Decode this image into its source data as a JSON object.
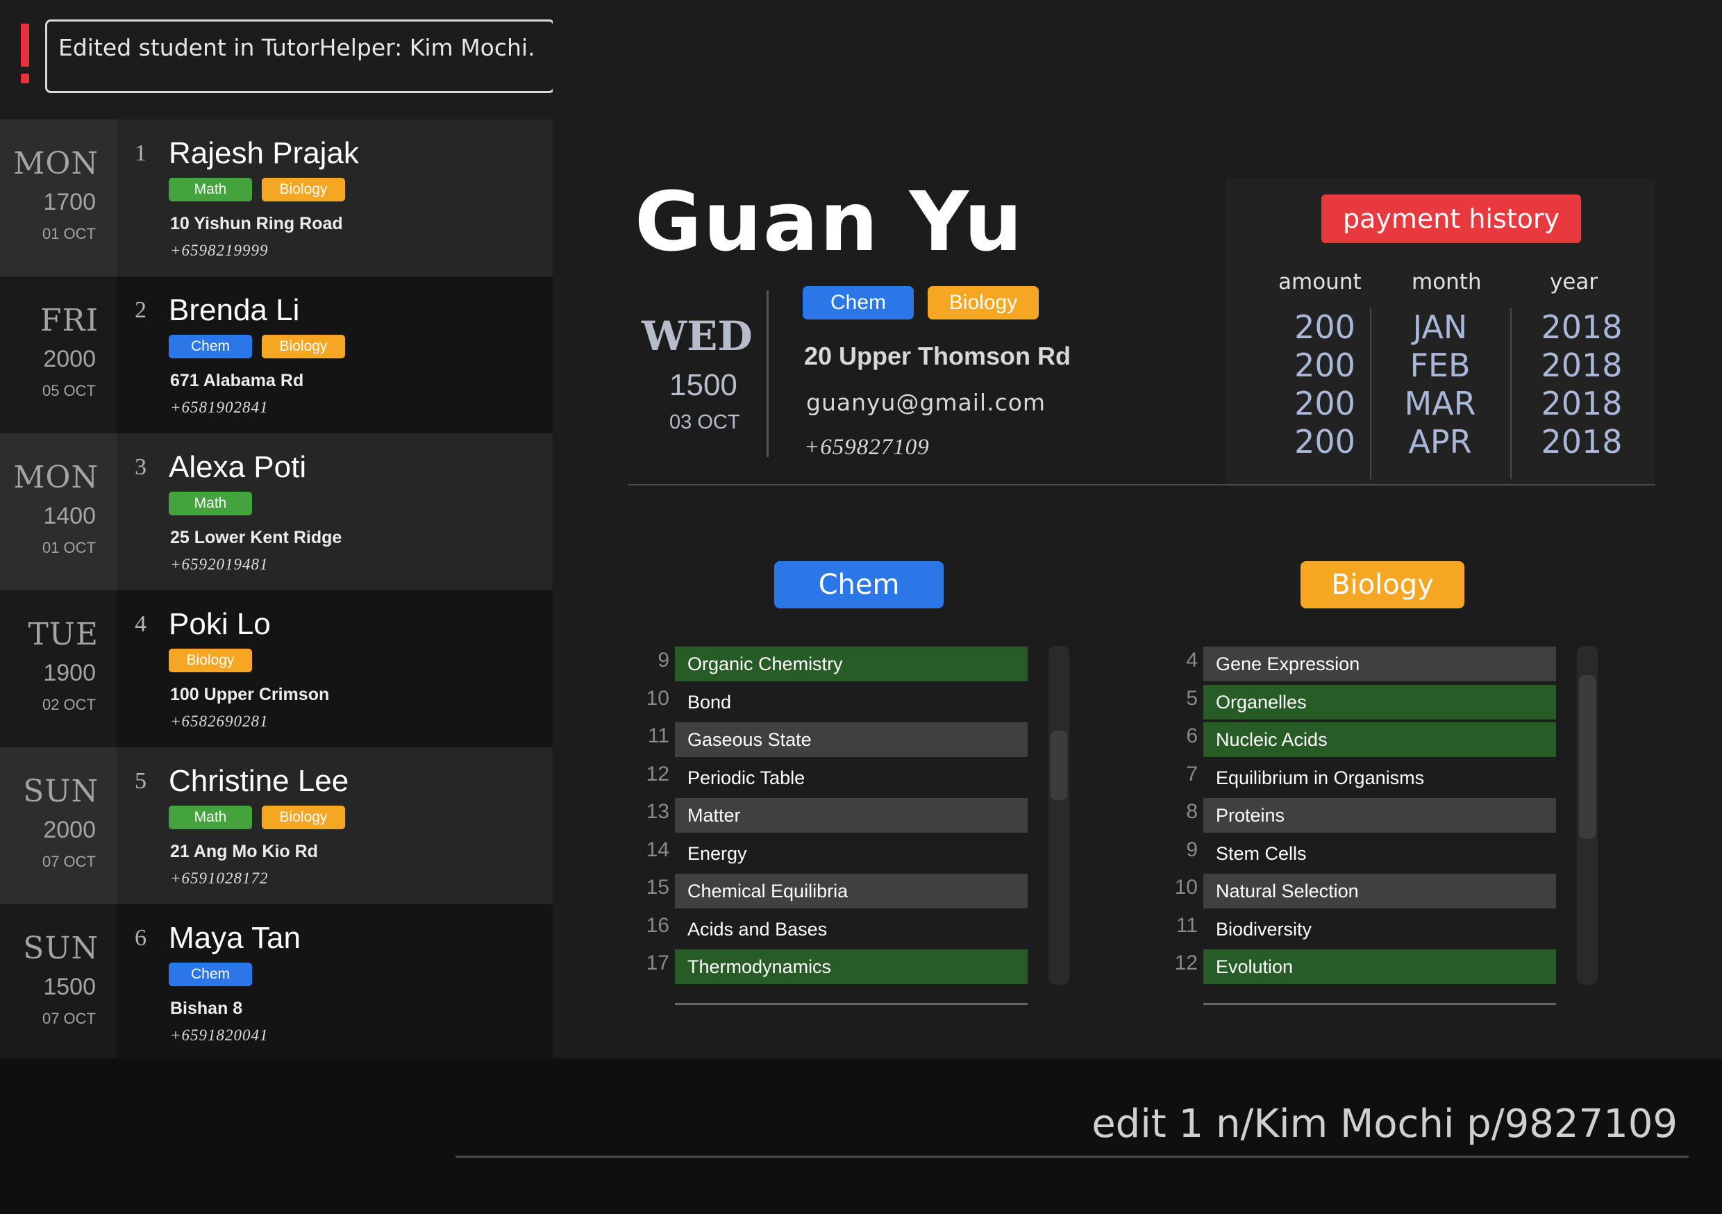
{
  "result": {
    "message": "Edited student in TutorHelper: Kim Mochi."
  },
  "students": [
    {
      "index": "1",
      "day": "MON",
      "time": "1700",
      "date": "01 OCT",
      "name": "Rajesh Prajak",
      "tags": [
        {
          "label": "Math",
          "color": "#44a33c"
        },
        {
          "label": "Biology",
          "color": "#f5a623"
        }
      ],
      "address": "10 Yishun Ring Road",
      "phone": "+6598219999"
    },
    {
      "index": "2",
      "day": "FRI",
      "time": "2000",
      "date": "05 OCT",
      "name": "Brenda Li",
      "tags": [
        {
          "label": "Chem",
          "color": "#2c77e8"
        },
        {
          "label": "Biology",
          "color": "#f5a623"
        }
      ],
      "address": "671 Alabama Rd",
      "phone": "+6581902841"
    },
    {
      "index": "3",
      "day": "MON",
      "time": "1400",
      "date": "01 OCT",
      "name": "Alexa Poti",
      "tags": [
        {
          "label": "Math",
          "color": "#44a33c"
        }
      ],
      "address": "25 Lower Kent Ridge",
      "phone": "+6592019481"
    },
    {
      "index": "4",
      "day": "TUE",
      "time": "1900",
      "date": "02 OCT",
      "name": "Poki Lo",
      "tags": [
        {
          "label": "Biology",
          "color": "#f5a623"
        }
      ],
      "address": "100 Upper Crimson",
      "phone": "+6582690281"
    },
    {
      "index": "5",
      "day": "SUN",
      "time": "2000",
      "date": "07 OCT",
      "name": "Christine Lee",
      "tags": [
        {
          "label": "Math",
          "color": "#44a33c"
        },
        {
          "label": "Biology",
          "color": "#f5a623"
        }
      ],
      "address": "21 Ang Mo Kio Rd",
      "phone": "+6591028172"
    },
    {
      "index": "6",
      "day": "SUN",
      "time": "1500",
      "date": "07 OCT",
      "name": "Maya Tan",
      "tags": [
        {
          "label": "Chem",
          "color": "#2c77e8"
        }
      ],
      "address": "Bishan 8",
      "phone": "+6591820041"
    }
  ],
  "details": {
    "name": "Guan Yu",
    "day": "WED",
    "time": "1500",
    "date": "03 OCT",
    "tags": [
      {
        "label": "Chem",
        "color": "#2c77e8"
      },
      {
        "label": "Biology",
        "color": "#f5a623"
      }
    ],
    "address": "20 Upper Thomson Rd",
    "email": "guanyu@gmail.com",
    "phone": "+659827109"
  },
  "payment": {
    "button_label": "payment history",
    "headers": {
      "amount": "amount",
      "month": "month",
      "year": "year"
    },
    "rows": [
      {
        "amount": "200",
        "month": "JAN",
        "year": "2018"
      },
      {
        "amount": "200",
        "month": "FEB",
        "year": "2018"
      },
      {
        "amount": "200",
        "month": "MAR",
        "year": "2018"
      },
      {
        "amount": "200",
        "month": "APR",
        "year": "2018"
      }
    ]
  },
  "subjects": [
    {
      "label": "Chem",
      "color": "#2c77e8",
      "topics": [
        {
          "num": "9",
          "name": "Organic Chemistry",
          "state": "done"
        },
        {
          "num": "10",
          "name": "Bond",
          "state": "plain"
        },
        {
          "num": "11",
          "name": "Gaseous State",
          "state": "gray"
        },
        {
          "num": "12",
          "name": "Periodic Table",
          "state": "plain"
        },
        {
          "num": "13",
          "name": "Matter",
          "state": "gray"
        },
        {
          "num": "14",
          "name": "Energy",
          "state": "plain"
        },
        {
          "num": "15",
          "name": "Chemical Equilibria",
          "state": "gray"
        },
        {
          "num": "16",
          "name": "Acids and Bases",
          "state": "plain"
        },
        {
          "num": "17",
          "name": "Thermodynamics",
          "state": "done"
        }
      ]
    },
    {
      "label": "Biology",
      "color": "#f5a623",
      "topics": [
        {
          "num": "4",
          "name": "Gene Expression",
          "state": "gray"
        },
        {
          "num": "5",
          "name": "Organelles",
          "state": "done"
        },
        {
          "num": "6",
          "name": "Nucleic Acids",
          "state": "done"
        },
        {
          "num": "7",
          "name": "Equilibrium in Organisms",
          "state": "plain"
        },
        {
          "num": "8",
          "name": "Proteins",
          "state": "gray"
        },
        {
          "num": "9",
          "name": "Stem Cells",
          "state": "plain"
        },
        {
          "num": "10",
          "name": "Natural Selection",
          "state": "gray"
        },
        {
          "num": "11",
          "name": "Biodiversity",
          "state": "plain"
        },
        {
          "num": "12",
          "name": "Evolution",
          "state": "done"
        }
      ]
    }
  ],
  "command": {
    "value": "edit 1 n/Kim Mochi p/9827109"
  },
  "icons": {
    "result_status": "exclamation-icon"
  },
  "colors": {
    "alert": "#e83a3e",
    "completed": "#275c27",
    "math": "#44a33c",
    "biology": "#f5a623",
    "chem": "#2c77e8"
  }
}
